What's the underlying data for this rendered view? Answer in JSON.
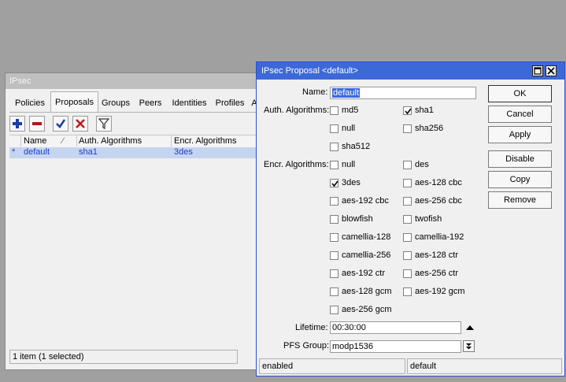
{
  "background_window": {
    "title": "IPsec",
    "tabs": [
      {
        "label": "Policies"
      },
      {
        "label": "Proposals"
      },
      {
        "label": "Groups"
      },
      {
        "label": "Peers"
      },
      {
        "label": "Identities"
      },
      {
        "label": "Profiles"
      },
      {
        "label": "A"
      }
    ],
    "active_tab": "Proposals",
    "toolbar": [
      "add-icon",
      "remove-icon",
      "enable-check-icon",
      "disable-x-icon",
      "filter-icon"
    ],
    "table": {
      "columns": [
        "Name",
        "Auth. Algorithms",
        "Encr. Algorithms"
      ],
      "rows": [
        {
          "marker": "*",
          "name": "default",
          "auth": "sha1",
          "encr": "3des"
        }
      ]
    },
    "status": "1 item (1 selected)"
  },
  "dialog": {
    "title": "IPsec Proposal <default>",
    "name_label": "Name:",
    "name_value": "default",
    "auth_label": "Auth. Algorithms:",
    "auth": [
      {
        "label": "md5",
        "checked": false
      },
      {
        "label": "sha1",
        "checked": true
      },
      {
        "label": "null",
        "checked": false
      },
      {
        "label": "sha256",
        "checked": false
      },
      {
        "label": "sha512",
        "checked": false
      }
    ],
    "encr_label": "Encr. Algorithms:",
    "encr": [
      {
        "label": "null",
        "checked": false
      },
      {
        "label": "des",
        "checked": false
      },
      {
        "label": "3des",
        "checked": true
      },
      {
        "label": "aes-128 cbc",
        "checked": false
      },
      {
        "label": "aes-192 cbc",
        "checked": false
      },
      {
        "label": "aes-256 cbc",
        "checked": false
      },
      {
        "label": "blowfish",
        "checked": false
      },
      {
        "label": "twofish",
        "checked": false
      },
      {
        "label": "camellia-128",
        "checked": false
      },
      {
        "label": "camellia-192",
        "checked": false
      },
      {
        "label": "camellia-256",
        "checked": false
      },
      {
        "label": "aes-128 ctr",
        "checked": false
      },
      {
        "label": "aes-192 ctr",
        "checked": false
      },
      {
        "label": "aes-256 ctr",
        "checked": false
      },
      {
        "label": "aes-128 gcm",
        "checked": false
      },
      {
        "label": "aes-192 gcm",
        "checked": false
      },
      {
        "label": "aes-256 gcm",
        "checked": false
      }
    ],
    "lifetime_label": "Lifetime:",
    "lifetime_value": "00:30:00",
    "pfs_label": "PFS Group:",
    "pfs_value": "modp1536",
    "buttons": {
      "ok": "OK",
      "cancel": "Cancel",
      "apply": "Apply",
      "disable": "Disable",
      "copy": "Copy",
      "remove": "Remove"
    },
    "status_left": "enabled",
    "status_right": "default"
  }
}
